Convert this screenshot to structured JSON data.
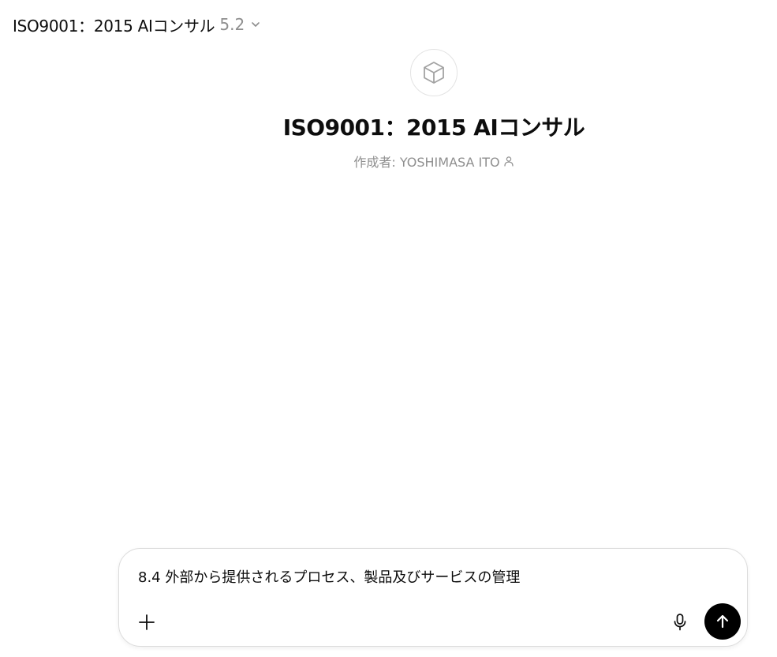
{
  "header": {
    "model_name": "ISO9001：2015 AIコンサル",
    "model_version": "5.2",
    "chevron_icon": "chevron-down-icon"
  },
  "gpt": {
    "avatar_icon": "cube-icon",
    "title": "ISO9001：2015 AIコンサル",
    "author_label": "作成者: YOSHIMASA ITO",
    "author_icon": "person-icon"
  },
  "composer": {
    "text": "8.4 外部から提供されるプロセス、製品及びサービスの管理",
    "plus_icon": "plus-icon",
    "mic_icon": "microphone-icon",
    "send_icon": "arrow-up-icon"
  },
  "colors": {
    "primary_text": "#0d0d0d",
    "secondary_text": "#8e8e8e",
    "send_button_bg": "#000000",
    "border": "#dcdcdc"
  }
}
